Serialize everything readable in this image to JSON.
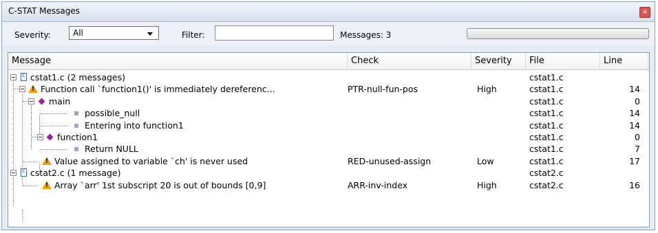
{
  "window": {
    "title": "C-STAT Messages"
  },
  "toolbar": {
    "severity_label": "Severity:",
    "severity_value": "All",
    "filter_label": "Filter:",
    "filter_value": "",
    "messages_label": "Messages: 3"
  },
  "columns": [
    "Message",
    "Check",
    "Severity",
    "File",
    "Line"
  ],
  "rows": [
    {
      "message": "cstat1.c  (2 messages)",
      "check": "",
      "severity": "",
      "file": "cstat1.c",
      "line": ""
    },
    {
      "message": "Function call `function1()' is immediately dereferenc...",
      "check": "PTR-null-fun-pos",
      "severity": "High",
      "file": "cstat1.c",
      "line": "14"
    },
    {
      "message": "main",
      "check": "",
      "severity": "",
      "file": "cstat1.c",
      "line": "0"
    },
    {
      "message": "possible_null",
      "check": "",
      "severity": "",
      "file": "cstat1.c",
      "line": "14"
    },
    {
      "message": "Entering into function1",
      "check": "",
      "severity": "",
      "file": "cstat1.c",
      "line": "14"
    },
    {
      "message": "function1",
      "check": "",
      "severity": "",
      "file": "cstat1.c",
      "line": "0"
    },
    {
      "message": "Return NULL",
      "check": "",
      "severity": "",
      "file": "cstat1.c",
      "line": "7"
    },
    {
      "message": "Value assigned to variable `ch' is never used",
      "check": "RED-unused-assign",
      "severity": "Low",
      "file": "cstat1.c",
      "line": "17"
    },
    {
      "message": "cstat2.c  (1 message)",
      "check": "",
      "severity": "",
      "file": "cstat2.c",
      "line": ""
    },
    {
      "message": "Array `arr' 1st subscript 20 is out of bounds [0,9]",
      "check": "ARR-inv-index",
      "severity": "High",
      "file": "cstat2.c",
      "line": "16"
    }
  ]
}
